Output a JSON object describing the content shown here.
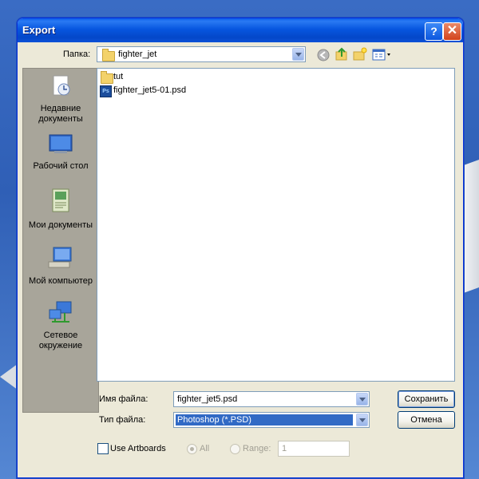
{
  "window": {
    "title": "Export",
    "help_glyph": "?",
    "close_glyph": "✕"
  },
  "location": {
    "label": "Папка:",
    "current_folder": "fighter_jet"
  },
  "toolbar": {
    "icons": [
      "back-icon",
      "up-folder-icon",
      "new-folder-icon",
      "view-menu-icon"
    ]
  },
  "places": [
    {
      "label": "Недавние документы",
      "icon": "recent-documents-icon"
    },
    {
      "label": "Рабочий стол",
      "icon": "desktop-icon"
    },
    {
      "label": "Мои документы",
      "icon": "my-documents-icon"
    },
    {
      "label": "Мой компьютер",
      "icon": "my-computer-icon"
    },
    {
      "label": "Сетевое окружение",
      "icon": "network-places-icon"
    }
  ],
  "files": [
    {
      "name": "tut",
      "type": "folder"
    },
    {
      "name": "fighter_jet5-01.psd",
      "type": "psd"
    }
  ],
  "filename": {
    "label": "Имя файла:",
    "value": "fighter_jet5.psd"
  },
  "filetype": {
    "label": "Тип файла:",
    "value": "Photoshop (*.PSD)"
  },
  "buttons": {
    "save": "Сохранить",
    "cancel": "Отмена"
  },
  "artboards": {
    "use_label": "Use Artboards",
    "all_label": "All",
    "range_label": "Range:",
    "range_value": "1"
  }
}
